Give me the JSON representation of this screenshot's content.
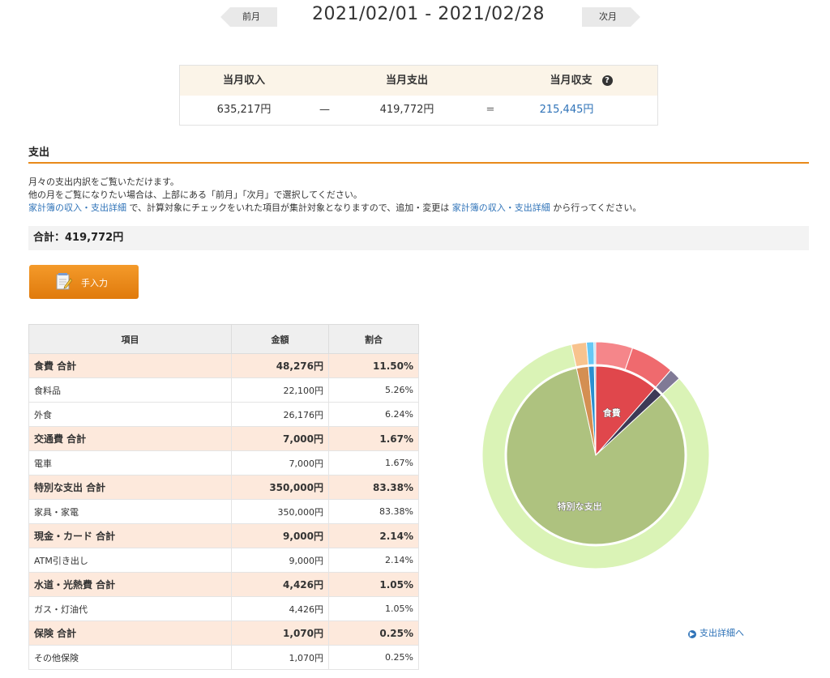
{
  "nav": {
    "prev_label": "前月",
    "next_label": "次月",
    "date_range": "2021/02/01 - 2021/02/28"
  },
  "summary": {
    "income_label": "当月収入",
    "expense_label": "当月支出",
    "balance_label": "当月収支",
    "income_value": "635,217円",
    "minus_sign": "—",
    "expense_value": "419,772円",
    "equals_sign": "=",
    "balance_value": "215,445円"
  },
  "section": {
    "title": "支出",
    "desc_line1": "月々の支出内訳をご覧いただけます。",
    "desc_line2": "他の月をご覧になりたい場合は、上部にある「前月」「次月」で選択してください。",
    "desc_link1": "家計簿の収入・支出詳細",
    "desc_line3_mid": " で、計算対象にチェックをいれた項目が集計対象となりますので、追加・変更は ",
    "desc_link2": "家計簿の収入・支出詳細",
    "desc_line3_end": " から行ってください。",
    "total": "合計：419,772円",
    "manual_button": "手入力",
    "detail_link": "支出詳細へ"
  },
  "table": {
    "headers": [
      "項目",
      "金額",
      "割合"
    ],
    "rows": [
      {
        "name": "食費 合計",
        "amount": "48,276円",
        "ratio": "11.50%",
        "group": true
      },
      {
        "name": "食料品",
        "amount": "22,100円",
        "ratio": "5.26%",
        "group": false
      },
      {
        "name": "外食",
        "amount": "26,176円",
        "ratio": "6.24%",
        "group": false
      },
      {
        "name": "交通費 合計",
        "amount": "7,000円",
        "ratio": "1.67%",
        "group": true
      },
      {
        "name": "電車",
        "amount": "7,000円",
        "ratio": "1.67%",
        "group": false
      },
      {
        "name": "特別な支出 合計",
        "amount": "350,000円",
        "ratio": "83.38%",
        "group": true
      },
      {
        "name": "家具・家電",
        "amount": "350,000円",
        "ratio": "83.38%",
        "group": false
      },
      {
        "name": "現金・カード 合計",
        "amount": "9,000円",
        "ratio": "2.14%",
        "group": true
      },
      {
        "name": "ATM引き出し",
        "amount": "9,000円",
        "ratio": "2.14%",
        "group": false
      },
      {
        "name": "水道・光熱費 合計",
        "amount": "4,426円",
        "ratio": "1.05%",
        "group": true
      },
      {
        "name": "ガス・灯油代",
        "amount": "4,426円",
        "ratio": "1.05%",
        "group": false
      },
      {
        "name": "保険 合計",
        "amount": "1,070円",
        "ratio": "0.25%",
        "group": true
      },
      {
        "name": "その他保険",
        "amount": "1,070円",
        "ratio": "0.25%",
        "group": false
      }
    ]
  },
  "chart_data": {
    "type": "pie",
    "inner": [
      {
        "name": "食費",
        "value": 48276,
        "color": "#e0474c",
        "label": "食費"
      },
      {
        "name": "交通費",
        "value": 7000,
        "color": "#3d3a56",
        "label": ""
      },
      {
        "name": "特別な支出",
        "value": 350000,
        "color": "#aec27f",
        "label": "特別な支出"
      },
      {
        "name": "現金・カード",
        "value": 9000,
        "color": "#d48f52",
        "label": ""
      },
      {
        "name": "水道・光熱費",
        "value": 4426,
        "color": "#2a8fd0",
        "label": ""
      },
      {
        "name": "保険",
        "value": 1070,
        "color": "#7bbbe0",
        "label": ""
      }
    ],
    "outer": [
      {
        "name": "食料品",
        "value": 22100,
        "color": "#f5868a"
      },
      {
        "name": "外食",
        "value": 26176,
        "color": "#ef6a6e"
      },
      {
        "name": "電車",
        "value": 7000,
        "color": "#807a96"
      },
      {
        "name": "家具・家電",
        "value": 350000,
        "color": "#daf3b6"
      },
      {
        "name": "ATM引き出し",
        "value": 9000,
        "color": "#f8c38e"
      },
      {
        "name": "ガス・灯油代",
        "value": 4426,
        "color": "#66c8f5"
      },
      {
        "name": "その他保険",
        "value": 1070,
        "color": "#a8dcf5"
      }
    ]
  }
}
